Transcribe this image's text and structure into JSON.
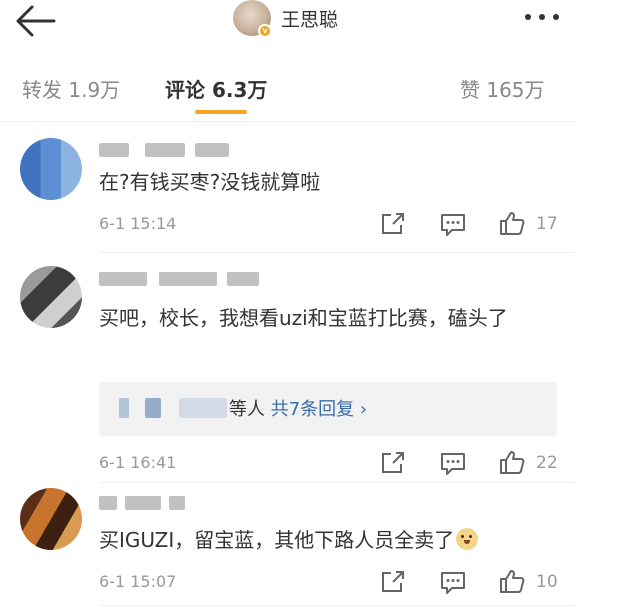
{
  "header": {
    "user_name": "王思聪",
    "verified_badge": "v",
    "back_icon": "back-arrow-icon",
    "more_icon": "more-dots-icon"
  },
  "tabs": {
    "repost": "转发 1.9万",
    "comment": "评论 6.3万",
    "like": "赞 165万",
    "active": "comment",
    "accent_color": "#f6a623"
  },
  "comments": [
    {
      "text": "在?有钱买枣?没钱就算啦",
      "time": "6-1 15:14",
      "like_count": "17"
    },
    {
      "text": "买吧，校长，我想看uzi和宝蓝打比赛，磕头了",
      "time": "6-1 16:41",
      "like_count": "22",
      "replies_summary": {
        "prefix": "等人",
        "link": "共7条回复 ›"
      }
    },
    {
      "text": "买IGUZI，留宝蓝，其他下路人员全卖了",
      "time": "6-1 15:07",
      "like_count": "10",
      "emoji": "doge-emoji"
    }
  ],
  "icons": {
    "share": "share-icon",
    "reply": "comment-icon",
    "like": "thumbs-up-icon"
  },
  "colors": {
    "link": "#3a6ea8",
    "muted": "#999999",
    "text": "#333333"
  }
}
